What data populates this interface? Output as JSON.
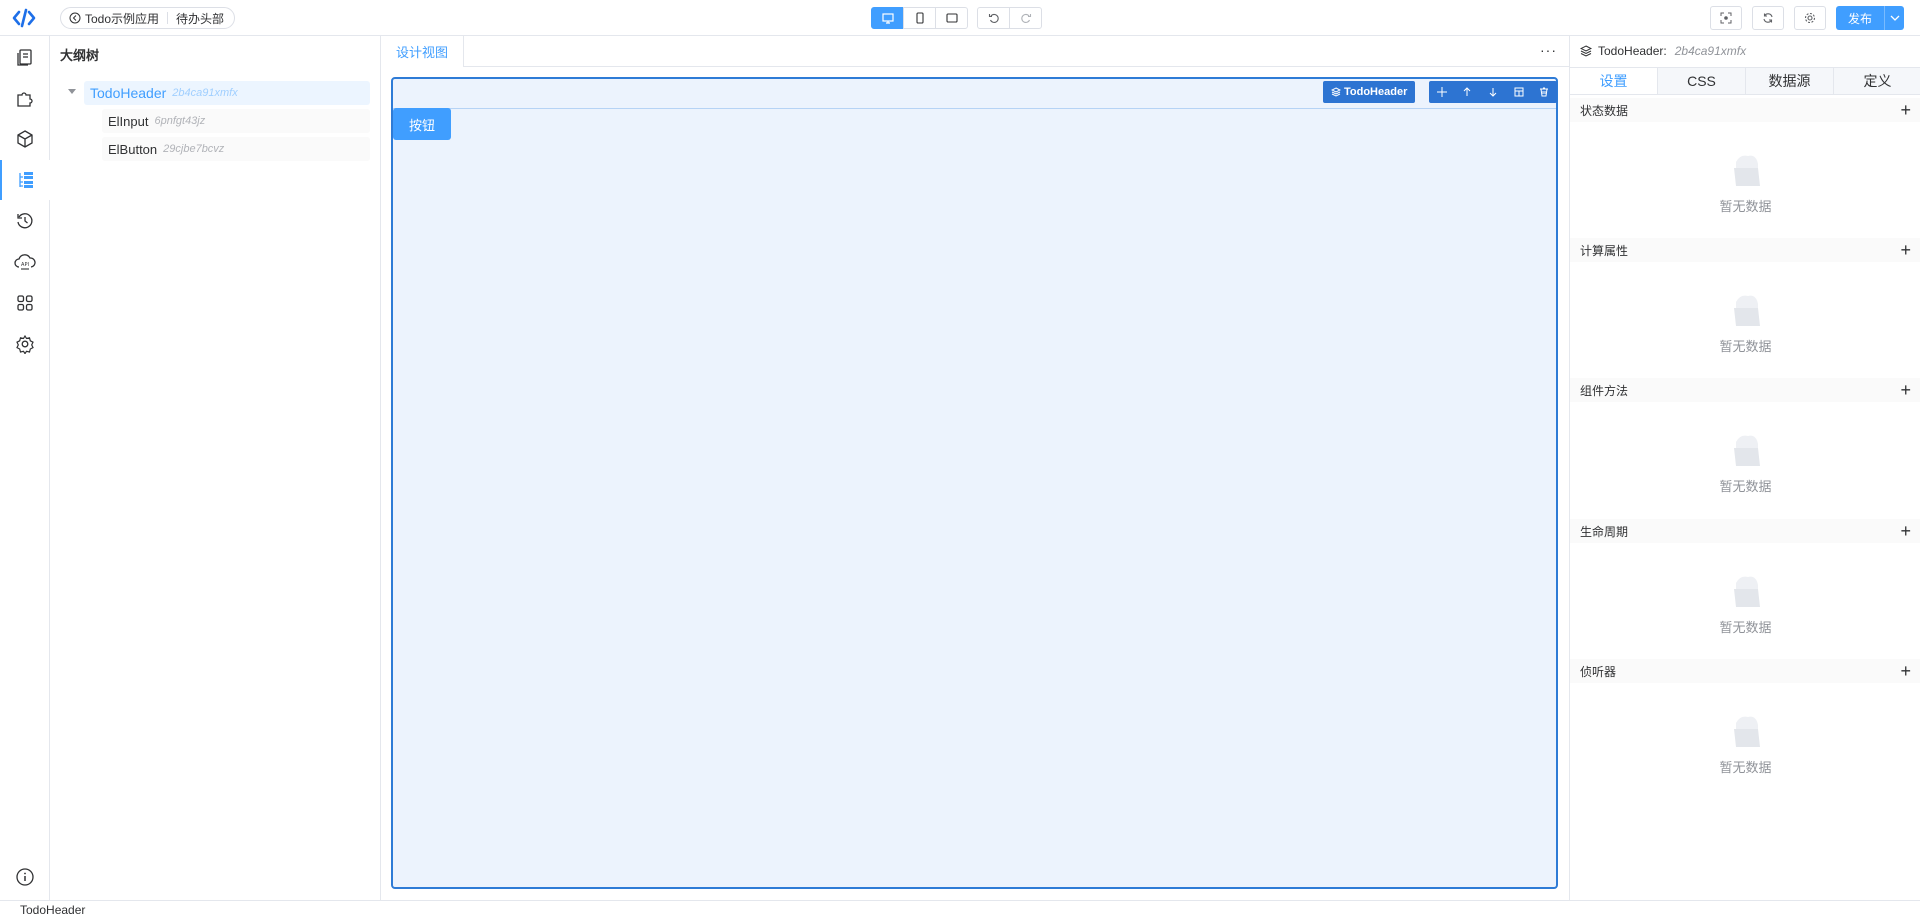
{
  "topbar": {
    "app_name": "Todo示例应用",
    "page_name": "待办头部",
    "publish_label": "发布"
  },
  "outline": {
    "title": "大纲树",
    "root": {
      "name": "TodoHeader",
      "id": "2b4ca91xmfx"
    },
    "children": [
      {
        "name": "ElInput",
        "id": "6pnfgt43jz"
      },
      {
        "name": "ElButton",
        "id": "29cjbe7bcvz"
      }
    ]
  },
  "center": {
    "tab_label": "设计视图",
    "component_badge": "TodoHeader",
    "canvas_button_label": "按钮"
  },
  "right": {
    "header_name": "TodoHeader:",
    "header_id": "2b4ca91xmfx",
    "tabs": [
      "设置",
      "CSS",
      "数据源",
      "定义"
    ],
    "sections": [
      {
        "title": "状态数据",
        "empty": "暂无数据"
      },
      {
        "title": "计算属性",
        "empty": "暂无数据"
      },
      {
        "title": "组件方法",
        "empty": "暂无数据"
      },
      {
        "title": "生命周期",
        "empty": "暂无数据"
      },
      {
        "title": "侦听器",
        "empty": "暂无数据"
      }
    ]
  },
  "statusbar": {
    "text": "TodoHeader"
  },
  "colors": {
    "accent": "#409eff",
    "selection": "#2d74d2",
    "canvas_bg": "#ecf3fd"
  }
}
